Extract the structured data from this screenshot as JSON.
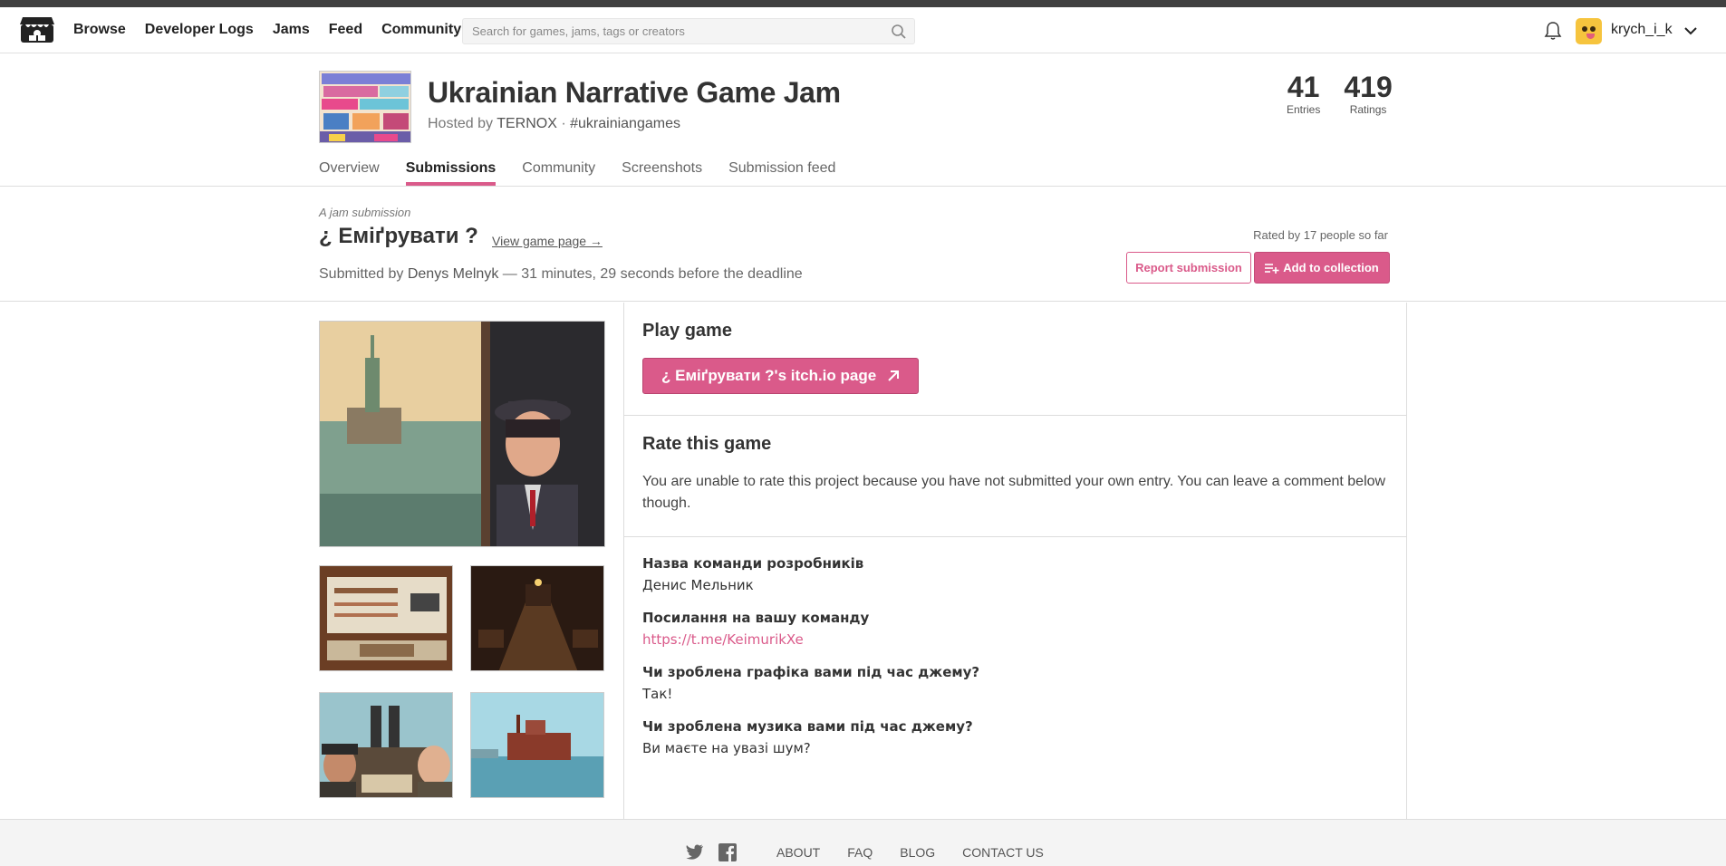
{
  "nav": {
    "items": [
      "Browse",
      "Developer Logs",
      "Jams",
      "Feed",
      "Community"
    ],
    "search_placeholder": "Search for games, jams, tags or creators",
    "username": "krych_i_k"
  },
  "jam": {
    "title": "Ukrainian Narrative Game Jam",
    "hosted_prefix": "Hosted by",
    "host": "TERNOX",
    "separator": "·",
    "hashtag": "#ukrainiangames",
    "stats": [
      {
        "value": "41",
        "label": "Entries"
      },
      {
        "value": "419",
        "label": "Ratings"
      }
    ],
    "tabs": [
      "Overview",
      "Submissions",
      "Community",
      "Screenshots",
      "Submission feed"
    ],
    "active_tab": "Submissions"
  },
  "submission": {
    "kicker": "A jam submission",
    "title": "¿ Еміґрувати ?",
    "view_link": "View game page →",
    "submitted_prefix": "Submitted by",
    "author": "Denys Melnyk",
    "submitted_suffix": "— 31 minutes, 29 seconds before the deadline",
    "rated_by": "Rated by 17 people so far",
    "report_label": "Report submission",
    "collection_label": "Add to collection"
  },
  "play": {
    "heading": "Play game",
    "button_label": "¿ Еміґрувати ?'s itch.io page"
  },
  "rate": {
    "heading": "Rate this game",
    "text": "You are unable to rate this project because you have not submitted your own entry. You can leave a comment below though."
  },
  "fields": [
    {
      "label": "Назва команди розробників",
      "value": "Денис Мельник"
    },
    {
      "label": "Посилання на вашу команду",
      "value": "https://t.me/KeimurikXe",
      "link": true
    },
    {
      "label": "Чи зроблена графіка вами під час джему?",
      "value": "Так!"
    },
    {
      "label": "Чи зроблена музика вами під час джему?",
      "value": "Ви маєте на увазі шум?"
    }
  ],
  "footer": {
    "links": [
      "About",
      "FAQ",
      "Blog",
      "Contact us"
    ]
  },
  "colors": {
    "accent": "#da5a8a",
    "topbar": "#404040"
  }
}
